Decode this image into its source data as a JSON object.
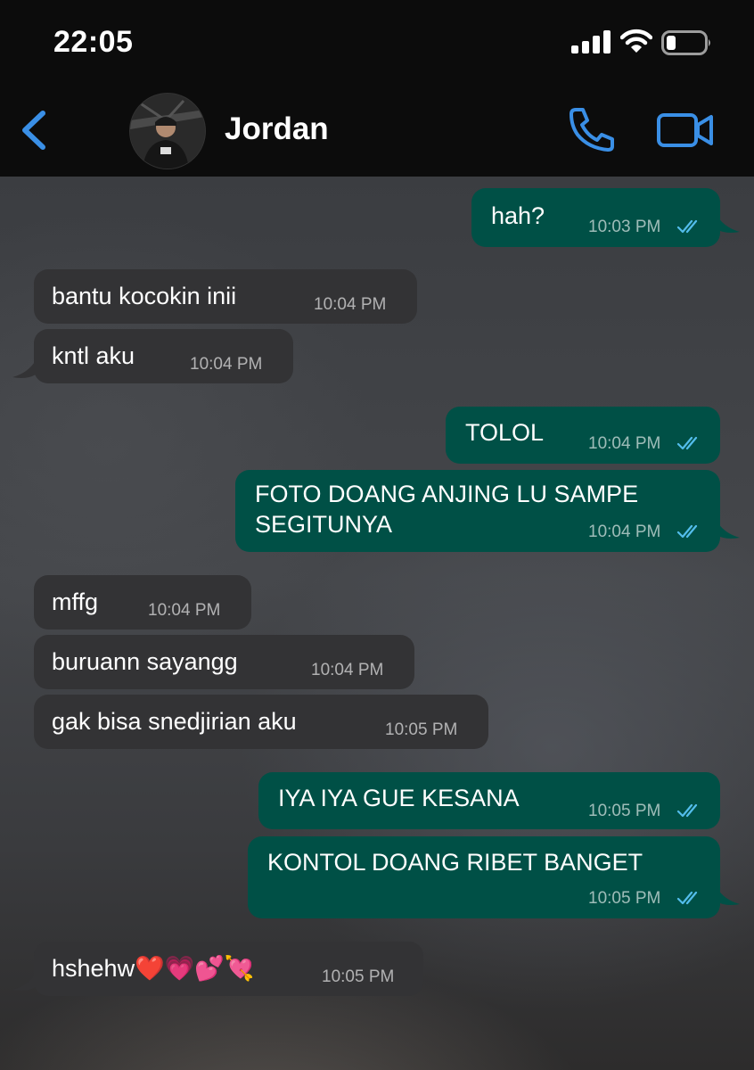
{
  "status_bar": {
    "time": "22:05"
  },
  "header": {
    "contact_name": "Jordan"
  },
  "messages": [
    {
      "dir": "out",
      "text": "hah?",
      "time": "10:03 PM"
    },
    {
      "dir": "in",
      "text": "bantu kocokin inii",
      "time": "10:04 PM"
    },
    {
      "dir": "in",
      "text": "kntl aku",
      "time": "10:04 PM"
    },
    {
      "dir": "out",
      "text": "TOLOL",
      "time": "10:04 PM"
    },
    {
      "dir": "out",
      "text_line1": "FOTO DOANG ANJING LU SAMPE",
      "text_line2": "SEGITUNYA",
      "time": "10:04 PM"
    },
    {
      "dir": "in",
      "text": "mffg",
      "time": "10:04 PM"
    },
    {
      "dir": "in",
      "text": "buruann sayangg",
      "time": "10:04 PM"
    },
    {
      "dir": "in",
      "text": "gak bisa snedjirian aku",
      "time": "10:05 PM"
    },
    {
      "dir": "out",
      "text": "IYA IYA GUE KESANA",
      "time": "10:05 PM"
    },
    {
      "dir": "out",
      "text": "KONTOL DOANG RIBET BANGET",
      "time": "10:05 PM"
    },
    {
      "dir": "in",
      "text": "hshehw",
      "emoji": "❤️💗💕💘",
      "time": "10:05 PM"
    }
  ],
  "colors": {
    "outgoing_bubble": "#005046",
    "incoming_bubble": "#333335",
    "accent": "#3a8fe6",
    "read_ticks": "#53bdeb"
  }
}
